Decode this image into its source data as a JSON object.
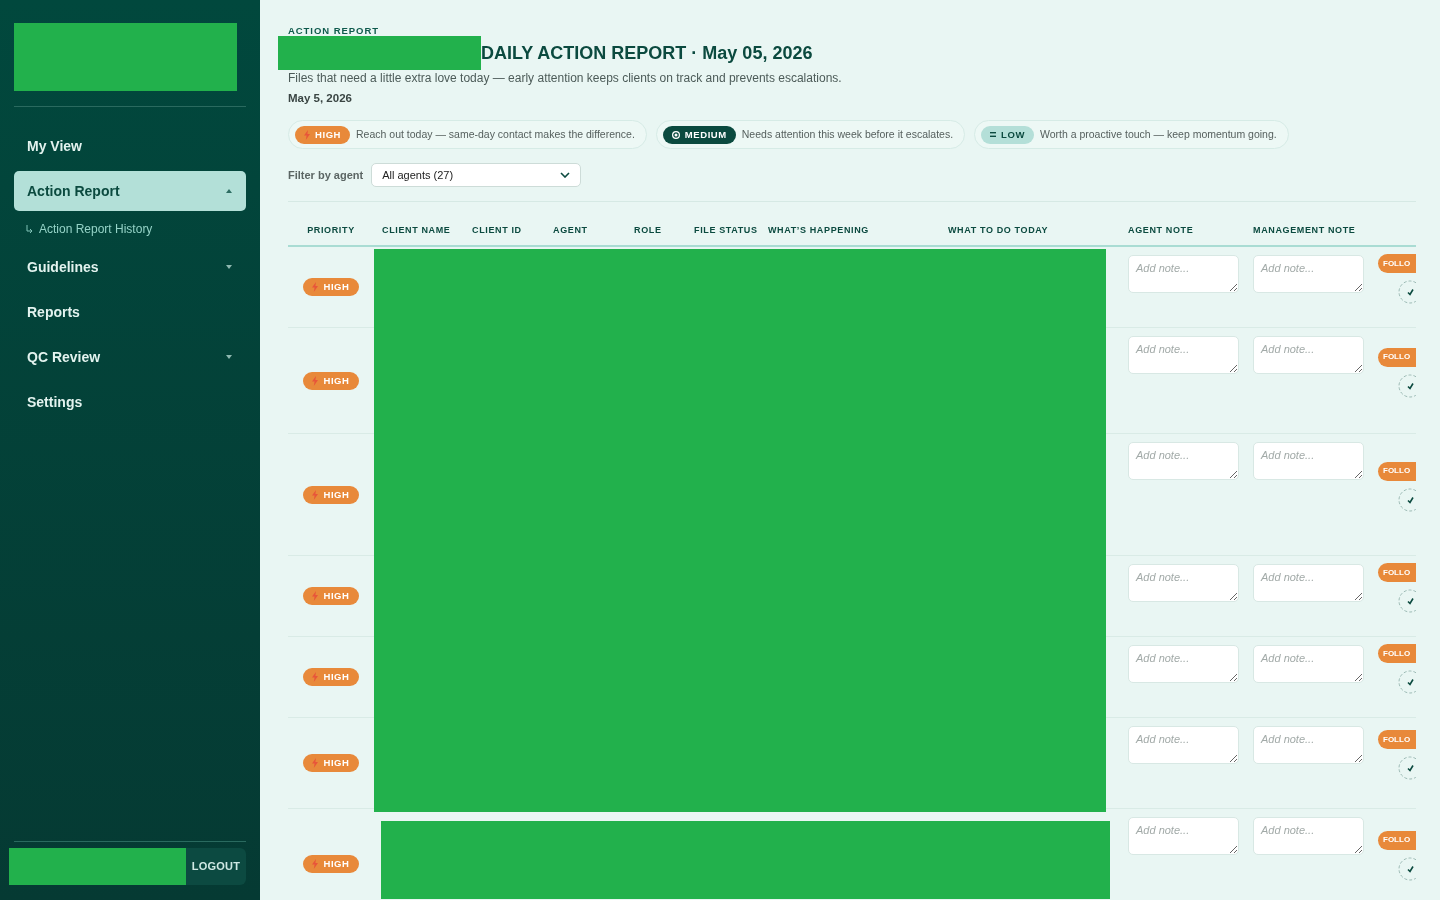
{
  "sidebar": {
    "nav": [
      {
        "label": "My View",
        "selected": false
      },
      {
        "label": "Action Report",
        "selected": true,
        "expanded": true,
        "children": [
          {
            "label": "Action Report History",
            "selected": false
          }
        ]
      },
      {
        "label": "Guidelines",
        "selected": false,
        "expanded": false
      },
      {
        "label": "Reports",
        "selected": false
      },
      {
        "label": "QC Review",
        "selected": false,
        "expanded": false
      },
      {
        "label": "Settings",
        "selected": false
      }
    ],
    "logout": "LOGOUT"
  },
  "header": {
    "eyebrow": "ACTION REPORT",
    "title": "DAILY ACTION REPORT · May 05, 2026",
    "subtitle": "Files that need a little extra love today — early attention keeps clients on track and prevents escalations.",
    "date": "May 5, 2026"
  },
  "legend": [
    {
      "kind": "high",
      "label": "HIGH",
      "description": "Reach out today — same-day contact makes the difference."
    },
    {
      "kind": "medium",
      "label": "MEDIUM",
      "description": "Needs attention this week before it escalates."
    },
    {
      "kind": "low",
      "label": "LOW",
      "description": "Worth a proactive touch — keep momentum going."
    }
  ],
  "filter": {
    "label": "Filter by agent",
    "value": "All agents (27)"
  },
  "table": {
    "columns": [
      "PRIORITY",
      "CLIENT NAME",
      "CLIENT ID",
      "AGENT",
      "ROLE",
      "FILE STATUS",
      "WHAT’S HAPPENING",
      "WHAT TO DO TODAY",
      "AGENT NOTE",
      "MANAGEMENT NOTE"
    ],
    "rows": [
      {
        "priority": {
          "kind": "high",
          "label": "HIGH"
        },
        "agent_note": {
          "placeholder": "Add note..."
        },
        "management_note": {
          "placeholder": "Add note..."
        },
        "action": "FOLLO",
        "checked": false
      },
      {
        "priority": {
          "kind": "high",
          "label": "HIGH"
        },
        "agent_note": {
          "placeholder": "Add note..."
        },
        "management_note": {
          "placeholder": "Add note..."
        },
        "action": "FOLLO",
        "checked": false
      },
      {
        "priority": {
          "kind": "high",
          "label": "HIGH"
        },
        "agent_note": {
          "placeholder": "Add note..."
        },
        "management_note": {
          "placeholder": "Add note..."
        },
        "action": "FOLLO",
        "checked": false
      },
      {
        "priority": {
          "kind": "high",
          "label": "HIGH"
        },
        "agent_note": {
          "placeholder": "Add note..."
        },
        "management_note": {
          "placeholder": "Add note..."
        },
        "action": "FOLLO",
        "checked": false
      },
      {
        "priority": {
          "kind": "high",
          "label": "HIGH"
        },
        "agent_note": {
          "placeholder": "Add note..."
        },
        "management_note": {
          "placeholder": "Add note..."
        },
        "action": "FOLLO",
        "checked": false
      },
      {
        "priority": {
          "kind": "high",
          "label": "HIGH"
        },
        "agent_note": {
          "placeholder": "Add note..."
        },
        "management_note": {
          "placeholder": "Add note..."
        },
        "action": "FOLLO",
        "checked": false
      },
      {
        "priority": {
          "kind": "high",
          "label": "HIGH"
        },
        "agent_note": {
          "placeholder": "Add note..."
        },
        "management_note": {
          "placeholder": "Add note..."
        },
        "action": "FOLLO",
        "checked": false
      }
    ]
  }
}
